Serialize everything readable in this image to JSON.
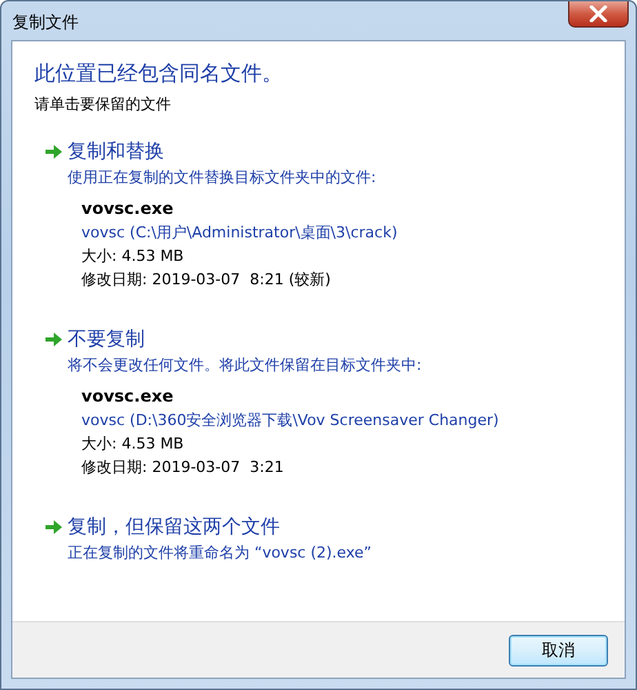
{
  "window": {
    "title": "复制文件"
  },
  "heading": "此位置已经包含同名文件。",
  "instruction": "请单击要保留的文件",
  "options": [
    {
      "title": "复制和替换",
      "description": "使用正在复制的文件替换目标文件夹中的文件:",
      "file": {
        "name": "vovsc.exe",
        "path": "vovsc (C:\\用户\\Administrator\\桌面\\3\\crack)",
        "size": "大小: 4.53 MB",
        "modified": "修改日期: 2019-03-07  8:21 (较新)"
      }
    },
    {
      "title": "不要复制",
      "description": "将不会更改任何文件。将此文件保留在目标文件夹中:",
      "file": {
        "name": "vovsc.exe",
        "path": "vovsc (D:\\360安全浏览器下载\\Vov Screensaver Changer)",
        "size": "大小: 4.53 MB",
        "modified": "修改日期: 2019-03-07  3:21"
      }
    },
    {
      "title": "复制，但保留这两个文件",
      "description": "正在复制的文件将重命名为 “vovsc (2).exe”"
    }
  ],
  "buttons": [
    {
      "label": "取消"
    }
  ]
}
